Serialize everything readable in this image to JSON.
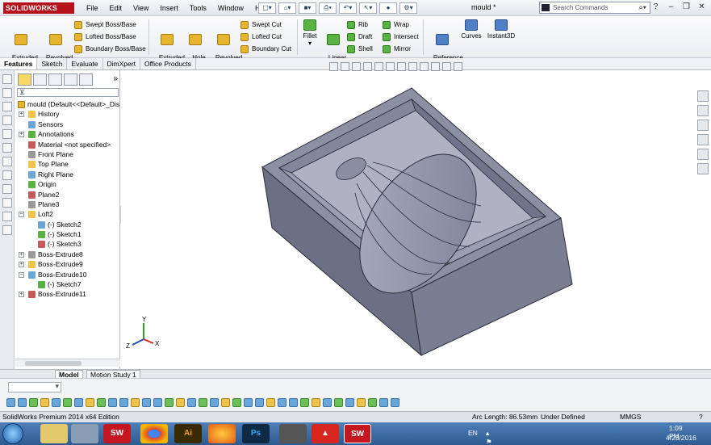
{
  "app": {
    "logo_text": "SOLIDWORKS",
    "menu": [
      "File",
      "Edit",
      "View",
      "Insert",
      "Tools",
      "Window",
      "Help"
    ],
    "document_title": "mould *",
    "search_placeholder": "Search Commands"
  },
  "ribbon": {
    "extruded_boss": "Extruded\nBoss/Base",
    "revolved_boss": "Revolved\nBoss/Base",
    "swept_boss": "Swept Boss/Base",
    "lofted_boss": "Lofted Boss/Base",
    "boundary_boss": "Boundary Boss/Base",
    "extruded_cut": "Extruded\nCut",
    "hole_wizard": "Hole\nWizard",
    "revolved_cut": "Revolved\nCut",
    "swept_cut": "Swept Cut",
    "lofted_cut": "Lofted Cut",
    "boundary_cut": "Boundary Cut",
    "fillet": "Fillet",
    "linear_pattern": "Linear\nPattern",
    "rib": "Rib",
    "draft": "Draft",
    "shell": "Shell",
    "wrap": "Wrap",
    "intersect": "Intersect",
    "mirror": "Mirror",
    "reference_geometry": "Reference\nGeometry",
    "curves": "Curves",
    "instant3d": "Instant3D"
  },
  "tabs": [
    "Features",
    "Sketch",
    "Evaluate",
    "DimXpert",
    "Office Products"
  ],
  "tree": {
    "root": "mould  (Default<<Default>_Dis",
    "items": [
      {
        "label": "History",
        "level": 1,
        "exp": "+"
      },
      {
        "label": "Sensors",
        "level": 1,
        "exp": ""
      },
      {
        "label": "Annotations",
        "level": 1,
        "exp": "+"
      },
      {
        "label": "Material <not specified>",
        "level": 1,
        "exp": ""
      },
      {
        "label": "Front Plane",
        "level": 1,
        "exp": ""
      },
      {
        "label": "Top Plane",
        "level": 1,
        "exp": ""
      },
      {
        "label": "Right Plane",
        "level": 1,
        "exp": ""
      },
      {
        "label": "Origin",
        "level": 1,
        "exp": ""
      },
      {
        "label": "Plane2",
        "level": 1,
        "exp": ""
      },
      {
        "label": "Plane3",
        "level": 1,
        "exp": ""
      },
      {
        "label": "Loft2",
        "level": 1,
        "exp": "−"
      },
      {
        "label": "(-) Sketch2",
        "level": 2,
        "exp": ""
      },
      {
        "label": "(-) Sketch1",
        "level": 2,
        "exp": ""
      },
      {
        "label": "(-) Sketch3",
        "level": 2,
        "exp": ""
      },
      {
        "label": "Boss-Extrude8",
        "level": 1,
        "exp": "+"
      },
      {
        "label": "Boss-Extrude9",
        "level": 1,
        "exp": "+"
      },
      {
        "label": "Boss-Extrude10",
        "level": 1,
        "exp": "−"
      },
      {
        "label": "(-) Sketch7",
        "level": 2,
        "exp": ""
      },
      {
        "label": "Boss-Extrude11",
        "level": 1,
        "exp": "+"
      }
    ]
  },
  "bottom_tabs": [
    "Model",
    "Motion Study 1"
  ],
  "status": {
    "edition": "SolidWorks Premium 2014 x64 Edition",
    "arc_length": "Arc Length: 86.53mm",
    "state": "Under Defined",
    "units": "MMGS"
  },
  "taskbar": {
    "lang": "EN",
    "time": "1:09 PM",
    "date": "4/23/2016",
    "apps": [
      "SW",
      "Chrome",
      "Ai",
      "Firefox",
      "Ps",
      "Tool",
      "Acrobat",
      "SW"
    ]
  },
  "triad": {
    "x": "X",
    "y": "Y",
    "z": "Z"
  },
  "colors": {
    "accent": "#b5121b",
    "part": "#8b8fa3"
  }
}
